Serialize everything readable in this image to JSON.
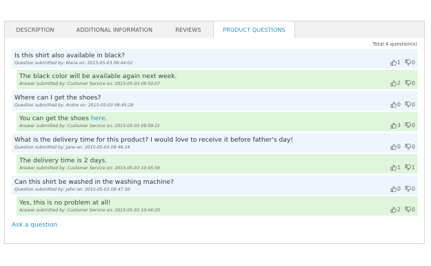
{
  "tabs": [
    {
      "label": "DESCRIPTION"
    },
    {
      "label": "ADDITIONAL INFORMATION"
    },
    {
      "label": "REVIEWS"
    },
    {
      "label": "PRODUCT QUESTIONS"
    }
  ],
  "total_label": "Total 4 question(s)",
  "entries": [
    {
      "type": "question",
      "text": "Is this shirt also available in black?",
      "meta": "Question submitted by: Maria on: 2015-05-03 09:44:02",
      "up": "1",
      "down": "0"
    },
    {
      "type": "answer",
      "text": "The black color will be available again next week.",
      "meta": "Answer submitted by: Customer Service on: 2015-05-03 09:50:07",
      "up": "2",
      "down": "0"
    },
    {
      "type": "question",
      "text": "Where can I get the shoes?",
      "meta": "Question submitted by: Andre on: 2015-05-03 09:45:29",
      "up": "0",
      "down": "0"
    },
    {
      "type": "answer",
      "text_before": "You can get the shoes ",
      "link": "here",
      "text_after": ".",
      "meta": "Answer submitted by: Customer Service on: 2015-05-03 09:59:21",
      "up": "3",
      "down": "0"
    },
    {
      "type": "question",
      "text": "What is the delivery time for this product? I would love to receive it before father's day!",
      "meta": "Question submitted by: Jane on: 2015-05-03 09:46:24",
      "up": "0",
      "down": "0"
    },
    {
      "type": "answer",
      "text": "The delivery time is 2 days.",
      "meta": "Answer submitted by: Customer Service on: 2015-05-03 10:45:56",
      "up": "1",
      "down": "1"
    },
    {
      "type": "question",
      "text": "Can this shirt be washed in the washing machine?",
      "meta": "Question submitted by: John on: 2015-05-03 09:47:30",
      "up": "0",
      "down": "0"
    },
    {
      "type": "answer",
      "text": "Yes, this is no problem at all!",
      "meta": "Answer submitted by: Customer Service on: 2015-05-03 10:46:20",
      "up": "2",
      "down": "0"
    }
  ],
  "ask_link": "Ask a question",
  "colors": {
    "accent": "#2f8fc6",
    "question_bg": "#eef5fc",
    "answer_bg": "#dff5dc"
  },
  "icons": {
    "up": "thumbs-up-icon",
    "down": "thumbs-down-icon"
  }
}
